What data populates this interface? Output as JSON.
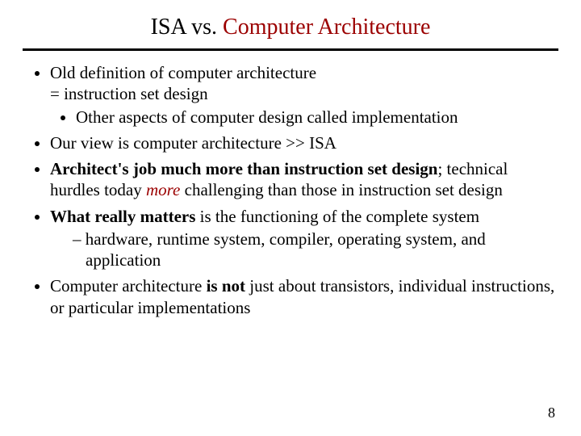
{
  "title": {
    "pre": "ISA vs. ",
    "accent": "Computer Architecture"
  },
  "bullets": {
    "b1_line1": "Old definition of computer architecture",
    "b1_line2": "= instruction set design",
    "b1_sub1": "Other aspects of computer design called implementation",
    "b2": "Our view is computer architecture >> ISA",
    "b3_bold": "Architect's job much more than instruction set design",
    "b3_after_semicolon": "; technical hurdles today ",
    "b3_more": "more",
    "b3_rest": " challenging than those in instruction set design",
    "b4_bold": "What really matters",
    "b4_rest": " is the functioning of the complete system",
    "b4_dash": "hardware, runtime system, compiler, operating system, and application",
    "b5_pre": "Computer architecture ",
    "b5_bold": "is not",
    "b5_rest": " just about transistors, individual instructions, or particular implementations"
  },
  "pagenum": "8"
}
